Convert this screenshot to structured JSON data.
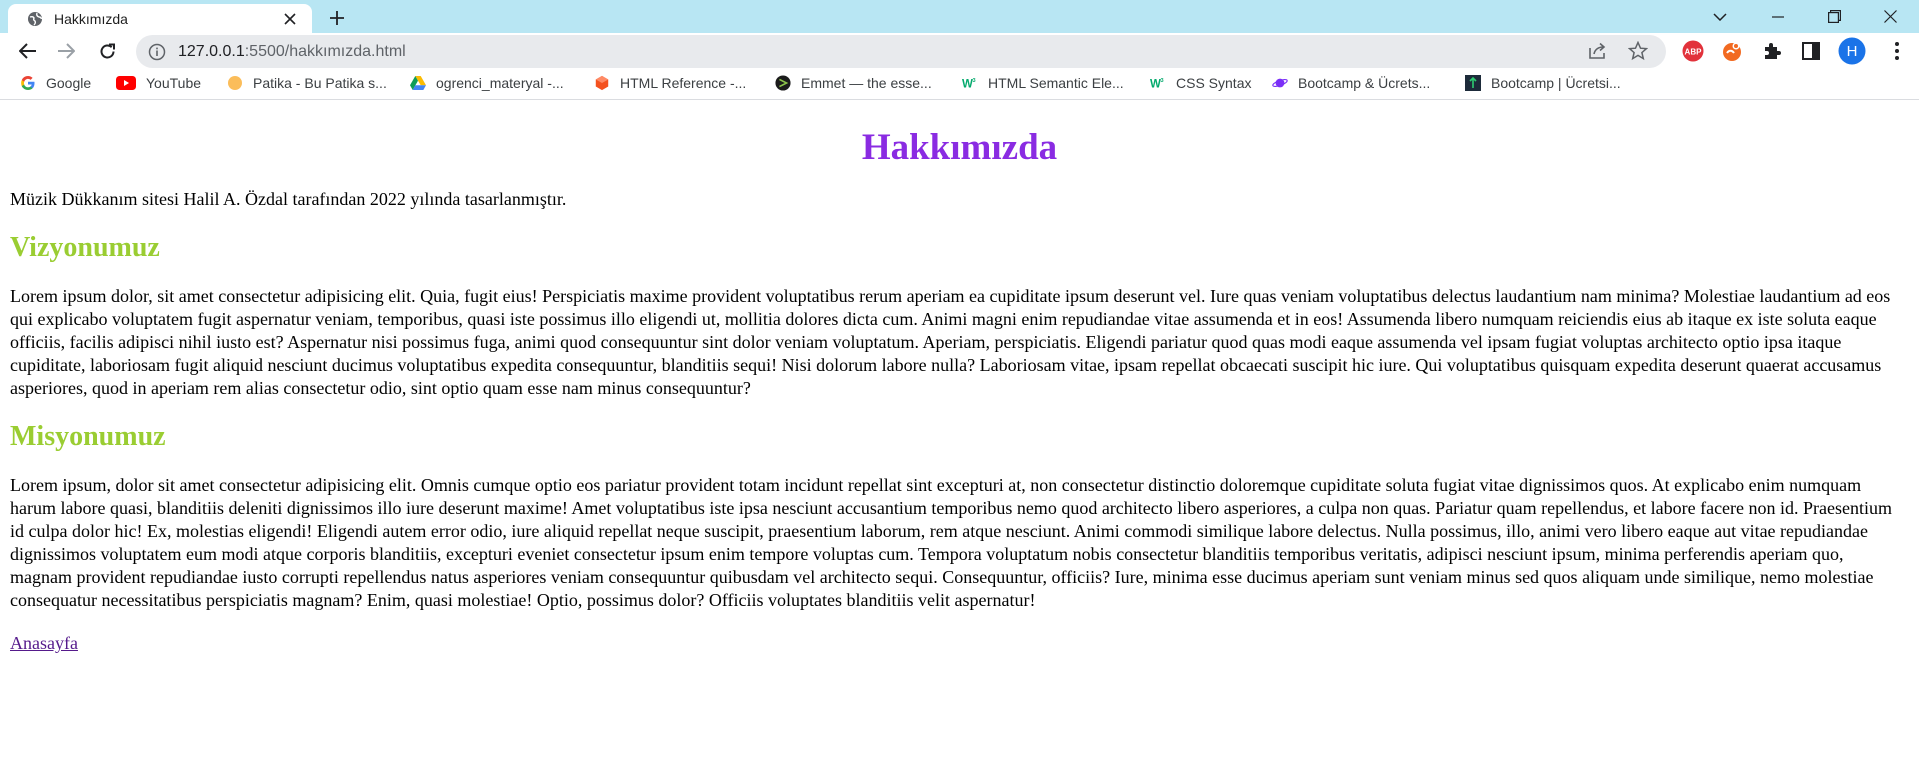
{
  "browser": {
    "tab_title": "Hakkımızda",
    "url": "127.0.0.1:5500/hakkımızda.html",
    "url_host": "127.0.0.1",
    "url_rest": ":5500/hakkımızda.html",
    "profile_initial": "H",
    "profile_color": "#1a73e8",
    "tabstrip_color": "#b8e6f3"
  },
  "bookmarks": [
    {
      "label": "Google",
      "icon": "google-icon"
    },
    {
      "label": "YouTube",
      "icon": "youtube-icon"
    },
    {
      "label": "Patika - Bu Patika s...",
      "icon": "patika-icon"
    },
    {
      "label": "ogrenci_materyal -...",
      "icon": "google-drive-icon"
    },
    {
      "label": "HTML Reference -...",
      "icon": "html-reference-icon"
    },
    {
      "label": "Emmet — the esse...",
      "icon": "emmet-icon"
    },
    {
      "label": "HTML Semantic Ele...",
      "icon": "w3schools-icon"
    },
    {
      "label": "CSS Syntax",
      "icon": "w3schools-icon"
    },
    {
      "label": "Bootcamp & Ücrets...",
      "icon": "planet-icon"
    },
    {
      "label": "Bootcamp | Ücretsi...",
      "icon": "bootcamp-icon"
    }
  ],
  "page": {
    "title": "Hakkımızda",
    "intro": "Müzik Dükkanım sitesi Halil A. Özdal tarafından 2022 yılında tasarlanmıştır.",
    "vision_heading": "Vizyonumuz",
    "vision_text": "Lorem ipsum dolor, sit amet consectetur adipisicing elit. Quia, fugit eius! Perspiciatis maxime provident voluptatibus rerum aperiam ea cupiditate ipsum deserunt vel. Iure quas veniam voluptatibus delectus laudantium nam minima? Molestiae laudantium ad eos qui explicabo voluptatem fugit aspernatur veniam, temporibus, quasi iste possimus illo eligendi ut, mollitia dolores dicta cum. Animi magni enim repudiandae vitae assumenda et in eos! Assumenda libero numquam reiciendis eius ab itaque ex iste soluta eaque officiis, facilis adipisci nihil iusto est? Aspernatur nisi possimus fuga, animi quod consequuntur sint dolor veniam voluptatum. Aperiam, perspiciatis. Eligendi pariatur quod quas modi eaque assumenda vel ipsam fugiat voluptas architecto optio ipsa itaque cupiditate, laboriosam fugit aliquid nesciunt ducimus voluptatibus expedita consequuntur, blanditiis sequi! Nisi dolorum labore nulla? Laboriosam vitae, ipsam repellat obcaecati suscipit hic iure. Qui voluptatibus quisquam expedita deserunt quaerat accusamus asperiores, quod in aperiam rem alias consectetur odio, sint optio quam esse nam minus consequuntur?",
    "mission_heading": "Misyonumuz",
    "mission_text": "Lorem ipsum, dolor sit amet consectetur adipisicing elit. Omnis cumque optio eos pariatur provident totam incidunt repellat sint excepturi at, non consectetur distinctio doloremque cupiditate soluta fugiat vitae dignissimos quos. At explicabo enim numquam harum labore quasi, blanditiis deleniti dignissimos illo iure deserunt maxime! Amet voluptatibus iste ipsa nesciunt accusantium temporibus nemo quod architecto libero asperiores, a culpa non quas. Pariatur quam repellendus, et labore facere non id. Praesentium id culpa dolor hic! Ex, molestias eligendi! Eligendi autem error odio, iure aliquid repellat neque suscipit, praesentium laborum, rem atque nesciunt. Animi commodi similique labore delectus. Nulla possimus, illo, animi vero libero eaque aut vitae repudiandae dignissimos voluptatem eum modi atque corporis blanditiis, excepturi eveniet consectetur ipsum enim tempore voluptas cum. Tempora voluptatum nobis consectetur blanditiis temporibus veritatis, adipisci nesciunt ipsum, minima perferendis aperiam quo, magnam provident repudiandae iusto corrupti repellendus natus asperiores veniam consequuntur quibusdam vel architecto sequi. Consequuntur, officiis? Iure, minima esse ducimus aperiam sunt veniam minus sed quos aliquam unde similique, nemo molestiae consequatur necessitatibus perspiciatis magnam? Enim, quasi molestiae! Optio, possimus dolor? Officiis voluptates blanditiis velit aspernatur!",
    "home_link": "Anasayfa",
    "title_color": "#8a2be2",
    "heading_color": "#9acd32"
  }
}
